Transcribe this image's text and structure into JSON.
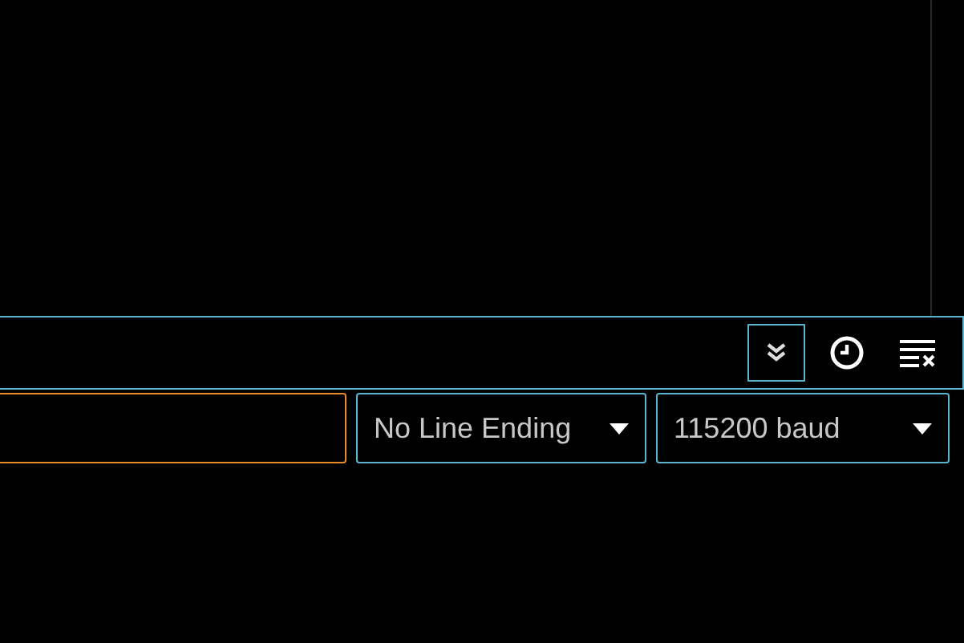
{
  "toolbar": {
    "buttons": [
      {
        "kind": "autoscroll",
        "selected": true
      },
      {
        "kind": "timestamp",
        "selected": false
      },
      {
        "kind": "clear",
        "selected": false
      }
    ]
  },
  "send_row": {
    "message": {
      "focused": true
    },
    "selects": [
      {
        "kind": "line_ending",
        "value": "No Line Ending"
      },
      {
        "kind": "baud",
        "value": "115200 baud"
      }
    ]
  }
}
